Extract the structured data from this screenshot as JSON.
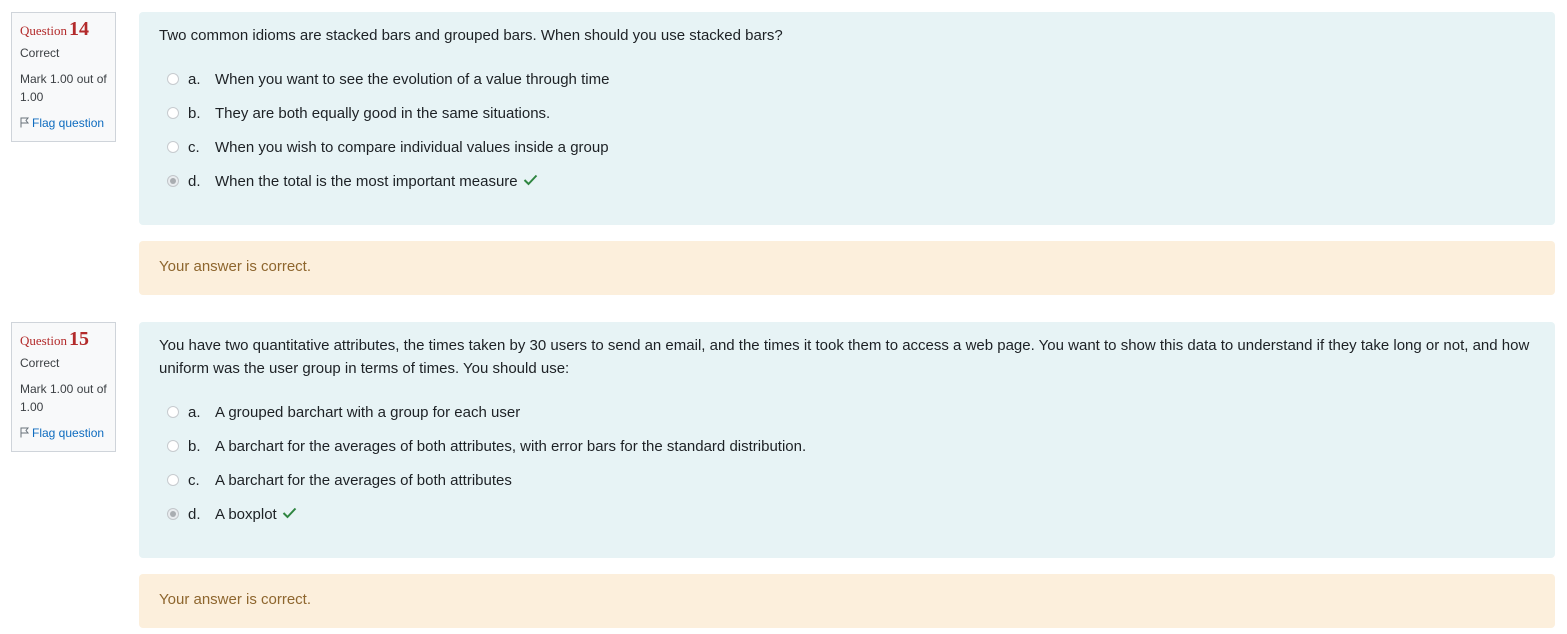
{
  "questions": [
    {
      "label": "Question",
      "number": "14",
      "state": "Correct",
      "grade": "Mark 1.00 out of 1.00",
      "flag_label": "Flag question",
      "text": "Two common idioms are stacked bars and grouped bars. When should you use stacked bars?",
      "answers": [
        {
          "letter": "a.",
          "text": "When you want to see the evolution of a value through time",
          "selected": false
        },
        {
          "letter": "b.",
          "text": "They are both equally good in the same situations.",
          "selected": false
        },
        {
          "letter": "c.",
          "text": "When you wish to compare individual values inside a group",
          "selected": false
        },
        {
          "letter": "d.",
          "text": "When the total is the most important measure",
          "selected": true
        }
      ],
      "feedback": "Your answer is correct."
    },
    {
      "label": "Question",
      "number": "15",
      "state": "Correct",
      "grade": "Mark 1.00 out of 1.00",
      "flag_label": "Flag question",
      "text": "You have two quantitative attributes, the times taken by 30 users to send an email, and the times it took them to access a web page. You want to show this data to understand if they take long or not, and how uniform was the user group in terms of times.  You should use:",
      "answers": [
        {
          "letter": "a.",
          "text": "A grouped barchart with a group for each user",
          "selected": false
        },
        {
          "letter": "b.",
          "text": "A barchart for the averages of both attributes, with error bars for the standard distribution.",
          "selected": false
        },
        {
          "letter": "c.",
          "text": "A barchart for the averages of both attributes",
          "selected": false
        },
        {
          "letter": "d.",
          "text": "A boxplot",
          "selected": true
        }
      ],
      "feedback": "Your answer is correct."
    }
  ],
  "icons": {
    "flag": "flag-icon",
    "correct": "check-icon"
  },
  "colors": {
    "correct_check": "#2e8540",
    "question_number": "#b32b2b",
    "link": "#0f6cbf",
    "feedback_text": "#8e662e"
  }
}
